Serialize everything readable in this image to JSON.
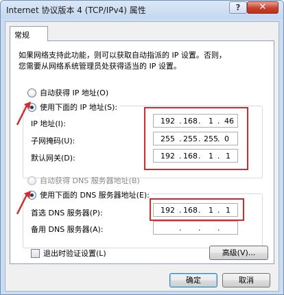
{
  "window": {
    "title": "Internet 协议版本 4 (TCP/IPv4) 属性",
    "help_label": "?",
    "close_label": "✕"
  },
  "tab": {
    "label": "常规"
  },
  "description": {
    "line1": "如果网络支持此功能，则可以获取自动指派的 IP 设置。否则，",
    "line2": "您需要从网络系统管理员处获得适当的 IP 设置。"
  },
  "ip": {
    "auto_label": "自动获得 IP 地址(O)",
    "manual_label": "使用下面的 IP 地址(S):",
    "fields": [
      {
        "label": "IP 地址(I):",
        "octets": [
          "192",
          "168",
          "1",
          "46"
        ]
      },
      {
        "label": "子网掩码(U):",
        "octets": [
          "255",
          "255",
          "255",
          "0"
        ]
      },
      {
        "label": "默认网关(D):",
        "octets": [
          "192",
          "168",
          "1",
          "1"
        ]
      }
    ]
  },
  "dns": {
    "auto_label": "自动获得 DNS 服务器地址(B)",
    "manual_label": "使用下面的 DNS 服务器地址(E):",
    "preferred": {
      "label": "首选 DNS 服务器(P):",
      "octets": [
        "192",
        "168",
        "1",
        "1"
      ]
    },
    "alternate": {
      "label": "备用 DNS 服务器(A):",
      "octets": [
        "",
        "",
        "",
        ""
      ]
    }
  },
  "validate_label": "退出时验证设置(L)",
  "advanced_label": "高级(V)...",
  "ok_label": "确定",
  "cancel_label": "取消",
  "colors": {
    "highlight": "#d9282c",
    "arrow": "#d9282c"
  }
}
